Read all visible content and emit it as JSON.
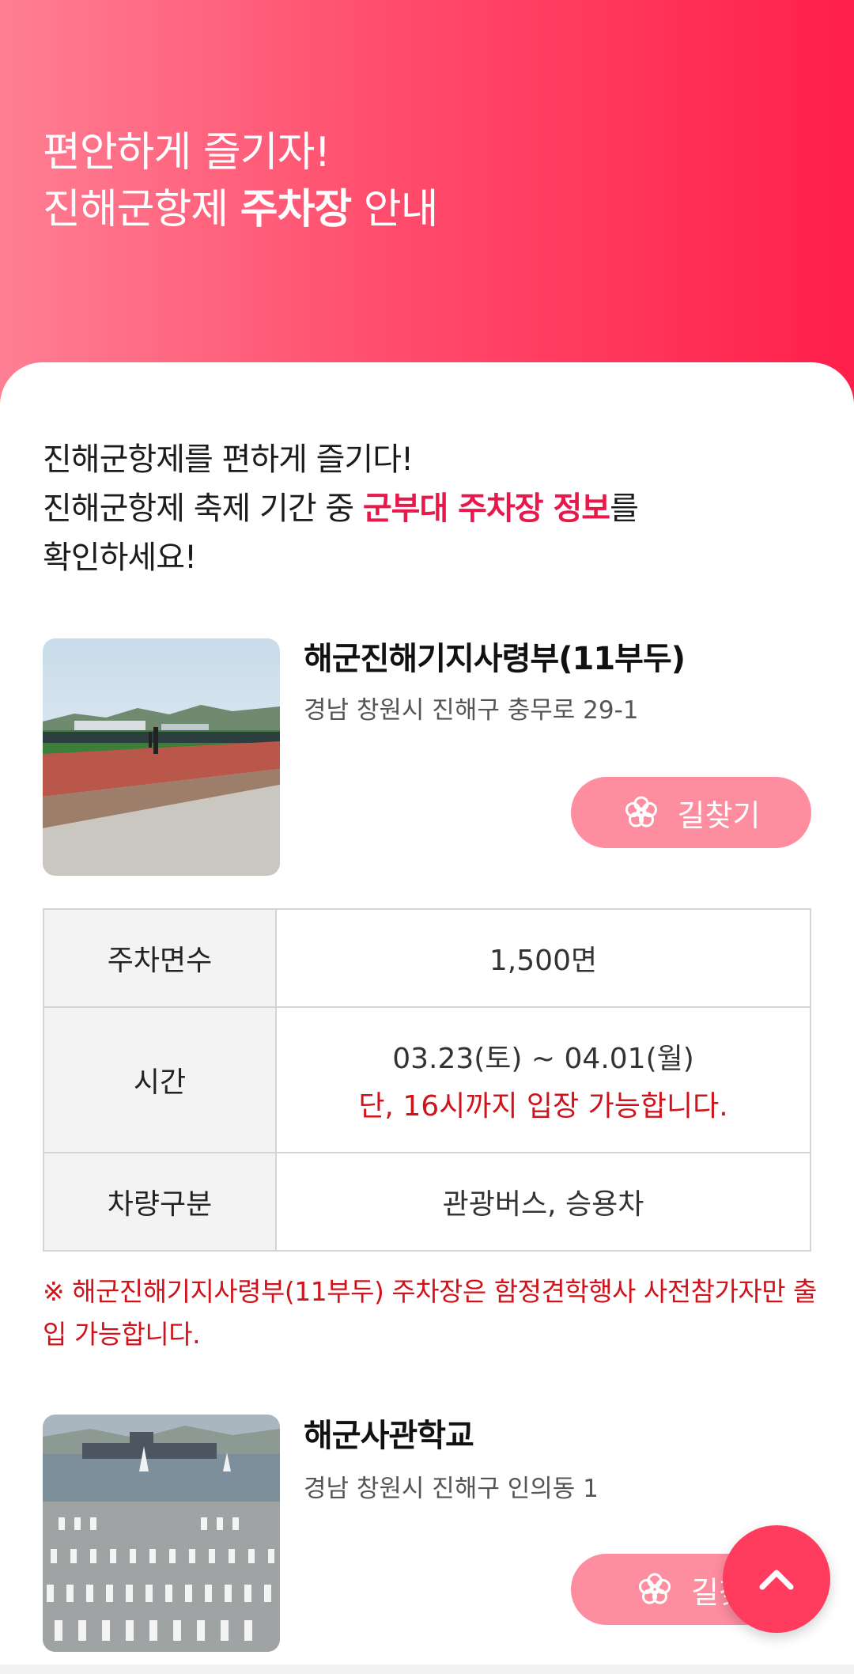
{
  "hero": {
    "line1": "편안하게 즐기자!",
    "line2_prefix": "진해군항제 ",
    "line2_bold": "주차장",
    "line2_suffix": " 안내"
  },
  "intro": {
    "line1": "진해군항제를 편하게 즐기다!",
    "line2_prefix": "진해군항제 축제 기간 중 ",
    "line2_highlight": "군부대 주차장 정보",
    "line2_suffix": "를",
    "line3": "확인하세요!"
  },
  "places": [
    {
      "name": "해군진해기지사령부(11부두)",
      "address": "경남 창원시 진해구 충무로 29-1",
      "route_label": "길찾기"
    },
    {
      "name": "해군사관학교",
      "address": "경남 창원시 진해구 인의동 1",
      "route_label": "길찾"
    }
  ],
  "table": {
    "spaces_label": "주차면수",
    "spaces_value": "1,500면",
    "time_label": "시간",
    "time_value": "03.23(토) ~ 04.01(월)",
    "time_note": "단, 16시까지 입장 가능합니다.",
    "vehicle_label": "차량구분",
    "vehicle_value": "관광버스, 승용차"
  },
  "notice": "※ 해군진해기지사령부(11부두) 주차장은 함정견학행사 사전참가자만 출입 가능합니다.",
  "colors": {
    "accent": "#e8194a",
    "button": "#ff8da0",
    "warning": "#d0121b",
    "top_button": "#ff3b5e"
  },
  "icons": {
    "route": "flower-icon",
    "top": "chevron-up-icon"
  }
}
